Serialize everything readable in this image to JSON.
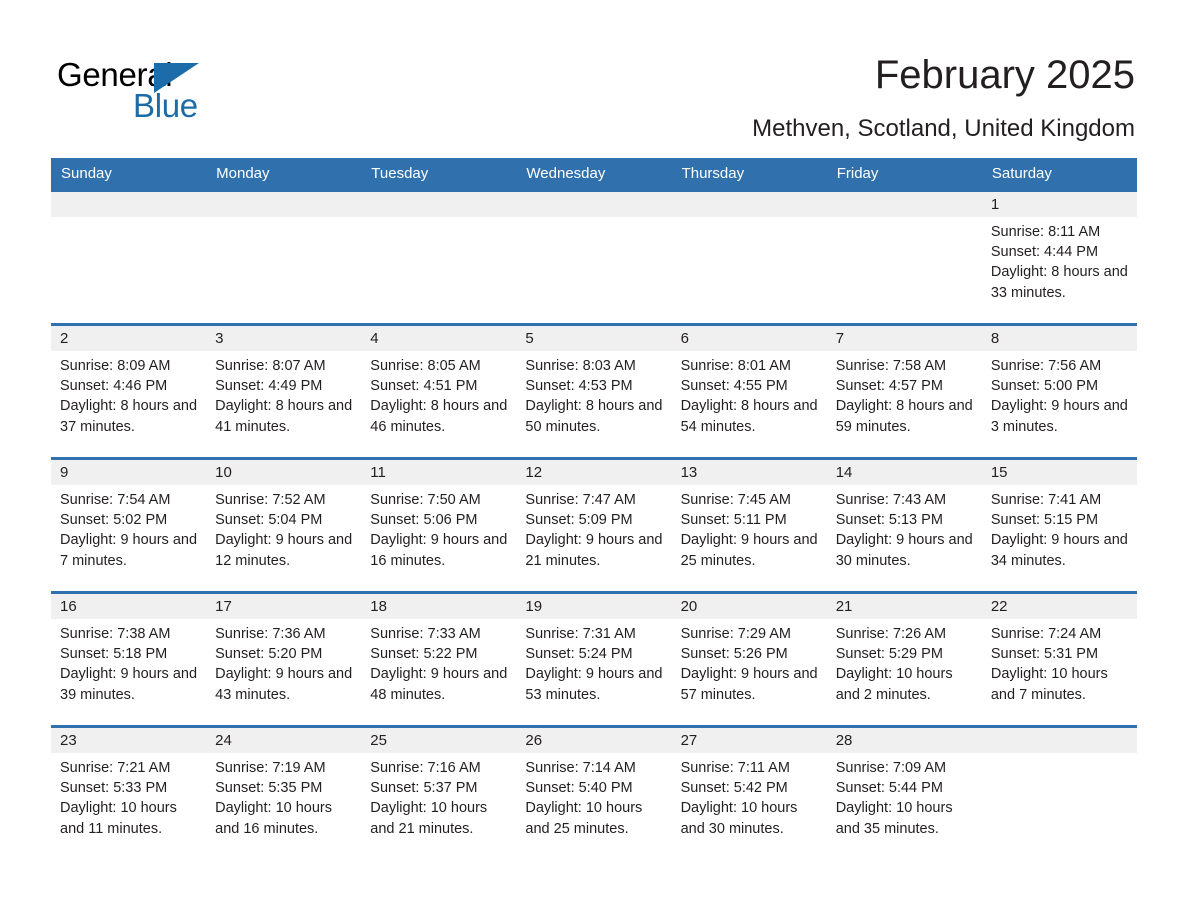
{
  "brand": {
    "logo_line1": "General",
    "logo_line2": "Blue",
    "logo_black": "#000000",
    "logo_blue": "#1b6ca8"
  },
  "header": {
    "title": "February 2025",
    "subtitle": "Methven, Scotland, United Kingdom"
  },
  "colors": {
    "header_row_blue": "#3071ad",
    "row_divider_blue": "#3071ad",
    "daynum_band_gray": "#f0f0f0",
    "text": "#231f20",
    "page_background": "#ffffff"
  },
  "weekday_headers": [
    "Sunday",
    "Monday",
    "Tuesday",
    "Wednesday",
    "Thursday",
    "Friday",
    "Saturday"
  ],
  "weeks": [
    [
      {
        "day": "",
        "sunrise": "",
        "sunset": "",
        "daylight": ""
      },
      {
        "day": "",
        "sunrise": "",
        "sunset": "",
        "daylight": ""
      },
      {
        "day": "",
        "sunrise": "",
        "sunset": "",
        "daylight": ""
      },
      {
        "day": "",
        "sunrise": "",
        "sunset": "",
        "daylight": ""
      },
      {
        "day": "",
        "sunrise": "",
        "sunset": "",
        "daylight": ""
      },
      {
        "day": "",
        "sunrise": "",
        "sunset": "",
        "daylight": ""
      },
      {
        "day": "1",
        "sunrise": "Sunrise: 8:11 AM",
        "sunset": "Sunset: 4:44 PM",
        "daylight": "Daylight: 8 hours and 33 minutes."
      }
    ],
    [
      {
        "day": "2",
        "sunrise": "Sunrise: 8:09 AM",
        "sunset": "Sunset: 4:46 PM",
        "daylight": "Daylight: 8 hours and 37 minutes."
      },
      {
        "day": "3",
        "sunrise": "Sunrise: 8:07 AM",
        "sunset": "Sunset: 4:49 PM",
        "daylight": "Daylight: 8 hours and 41 minutes."
      },
      {
        "day": "4",
        "sunrise": "Sunrise: 8:05 AM",
        "sunset": "Sunset: 4:51 PM",
        "daylight": "Daylight: 8 hours and 46 minutes."
      },
      {
        "day": "5",
        "sunrise": "Sunrise: 8:03 AM",
        "sunset": "Sunset: 4:53 PM",
        "daylight": "Daylight: 8 hours and 50 minutes."
      },
      {
        "day": "6",
        "sunrise": "Sunrise: 8:01 AM",
        "sunset": "Sunset: 4:55 PM",
        "daylight": "Daylight: 8 hours and 54 minutes."
      },
      {
        "day": "7",
        "sunrise": "Sunrise: 7:58 AM",
        "sunset": "Sunset: 4:57 PM",
        "daylight": "Daylight: 8 hours and 59 minutes."
      },
      {
        "day": "8",
        "sunrise": "Sunrise: 7:56 AM",
        "sunset": "Sunset: 5:00 PM",
        "daylight": "Daylight: 9 hours and 3 minutes."
      }
    ],
    [
      {
        "day": "9",
        "sunrise": "Sunrise: 7:54 AM",
        "sunset": "Sunset: 5:02 PM",
        "daylight": "Daylight: 9 hours and 7 minutes."
      },
      {
        "day": "10",
        "sunrise": "Sunrise: 7:52 AM",
        "sunset": "Sunset: 5:04 PM",
        "daylight": "Daylight: 9 hours and 12 minutes."
      },
      {
        "day": "11",
        "sunrise": "Sunrise: 7:50 AM",
        "sunset": "Sunset: 5:06 PM",
        "daylight": "Daylight: 9 hours and 16 minutes."
      },
      {
        "day": "12",
        "sunrise": "Sunrise: 7:47 AM",
        "sunset": "Sunset: 5:09 PM",
        "daylight": "Daylight: 9 hours and 21 minutes."
      },
      {
        "day": "13",
        "sunrise": "Sunrise: 7:45 AM",
        "sunset": "Sunset: 5:11 PM",
        "daylight": "Daylight: 9 hours and 25 minutes."
      },
      {
        "day": "14",
        "sunrise": "Sunrise: 7:43 AM",
        "sunset": "Sunset: 5:13 PM",
        "daylight": "Daylight: 9 hours and 30 minutes."
      },
      {
        "day": "15",
        "sunrise": "Sunrise: 7:41 AM",
        "sunset": "Sunset: 5:15 PM",
        "daylight": "Daylight: 9 hours and 34 minutes."
      }
    ],
    [
      {
        "day": "16",
        "sunrise": "Sunrise: 7:38 AM",
        "sunset": "Sunset: 5:18 PM",
        "daylight": "Daylight: 9 hours and 39 minutes."
      },
      {
        "day": "17",
        "sunrise": "Sunrise: 7:36 AM",
        "sunset": "Sunset: 5:20 PM",
        "daylight": "Daylight: 9 hours and 43 minutes."
      },
      {
        "day": "18",
        "sunrise": "Sunrise: 7:33 AM",
        "sunset": "Sunset: 5:22 PM",
        "daylight": "Daylight: 9 hours and 48 minutes."
      },
      {
        "day": "19",
        "sunrise": "Sunrise: 7:31 AM",
        "sunset": "Sunset: 5:24 PM",
        "daylight": "Daylight: 9 hours and 53 minutes."
      },
      {
        "day": "20",
        "sunrise": "Sunrise: 7:29 AM",
        "sunset": "Sunset: 5:26 PM",
        "daylight": "Daylight: 9 hours and 57 minutes."
      },
      {
        "day": "21",
        "sunrise": "Sunrise: 7:26 AM",
        "sunset": "Sunset: 5:29 PM",
        "daylight": "Daylight: 10 hours and 2 minutes."
      },
      {
        "day": "22",
        "sunrise": "Sunrise: 7:24 AM",
        "sunset": "Sunset: 5:31 PM",
        "daylight": "Daylight: 10 hours and 7 minutes."
      }
    ],
    [
      {
        "day": "23",
        "sunrise": "Sunrise: 7:21 AM",
        "sunset": "Sunset: 5:33 PM",
        "daylight": "Daylight: 10 hours and 11 minutes."
      },
      {
        "day": "24",
        "sunrise": "Sunrise: 7:19 AM",
        "sunset": "Sunset: 5:35 PM",
        "daylight": "Daylight: 10 hours and 16 minutes."
      },
      {
        "day": "25",
        "sunrise": "Sunrise: 7:16 AM",
        "sunset": "Sunset: 5:37 PM",
        "daylight": "Daylight: 10 hours and 21 minutes."
      },
      {
        "day": "26",
        "sunrise": "Sunrise: 7:14 AM",
        "sunset": "Sunset: 5:40 PM",
        "daylight": "Daylight: 10 hours and 25 minutes."
      },
      {
        "day": "27",
        "sunrise": "Sunrise: 7:11 AM",
        "sunset": "Sunset: 5:42 PM",
        "daylight": "Daylight: 10 hours and 30 minutes."
      },
      {
        "day": "28",
        "sunrise": "Sunrise: 7:09 AM",
        "sunset": "Sunset: 5:44 PM",
        "daylight": "Daylight: 10 hours and 35 minutes."
      },
      {
        "day": "",
        "sunrise": "",
        "sunset": "",
        "daylight": ""
      }
    ]
  ]
}
